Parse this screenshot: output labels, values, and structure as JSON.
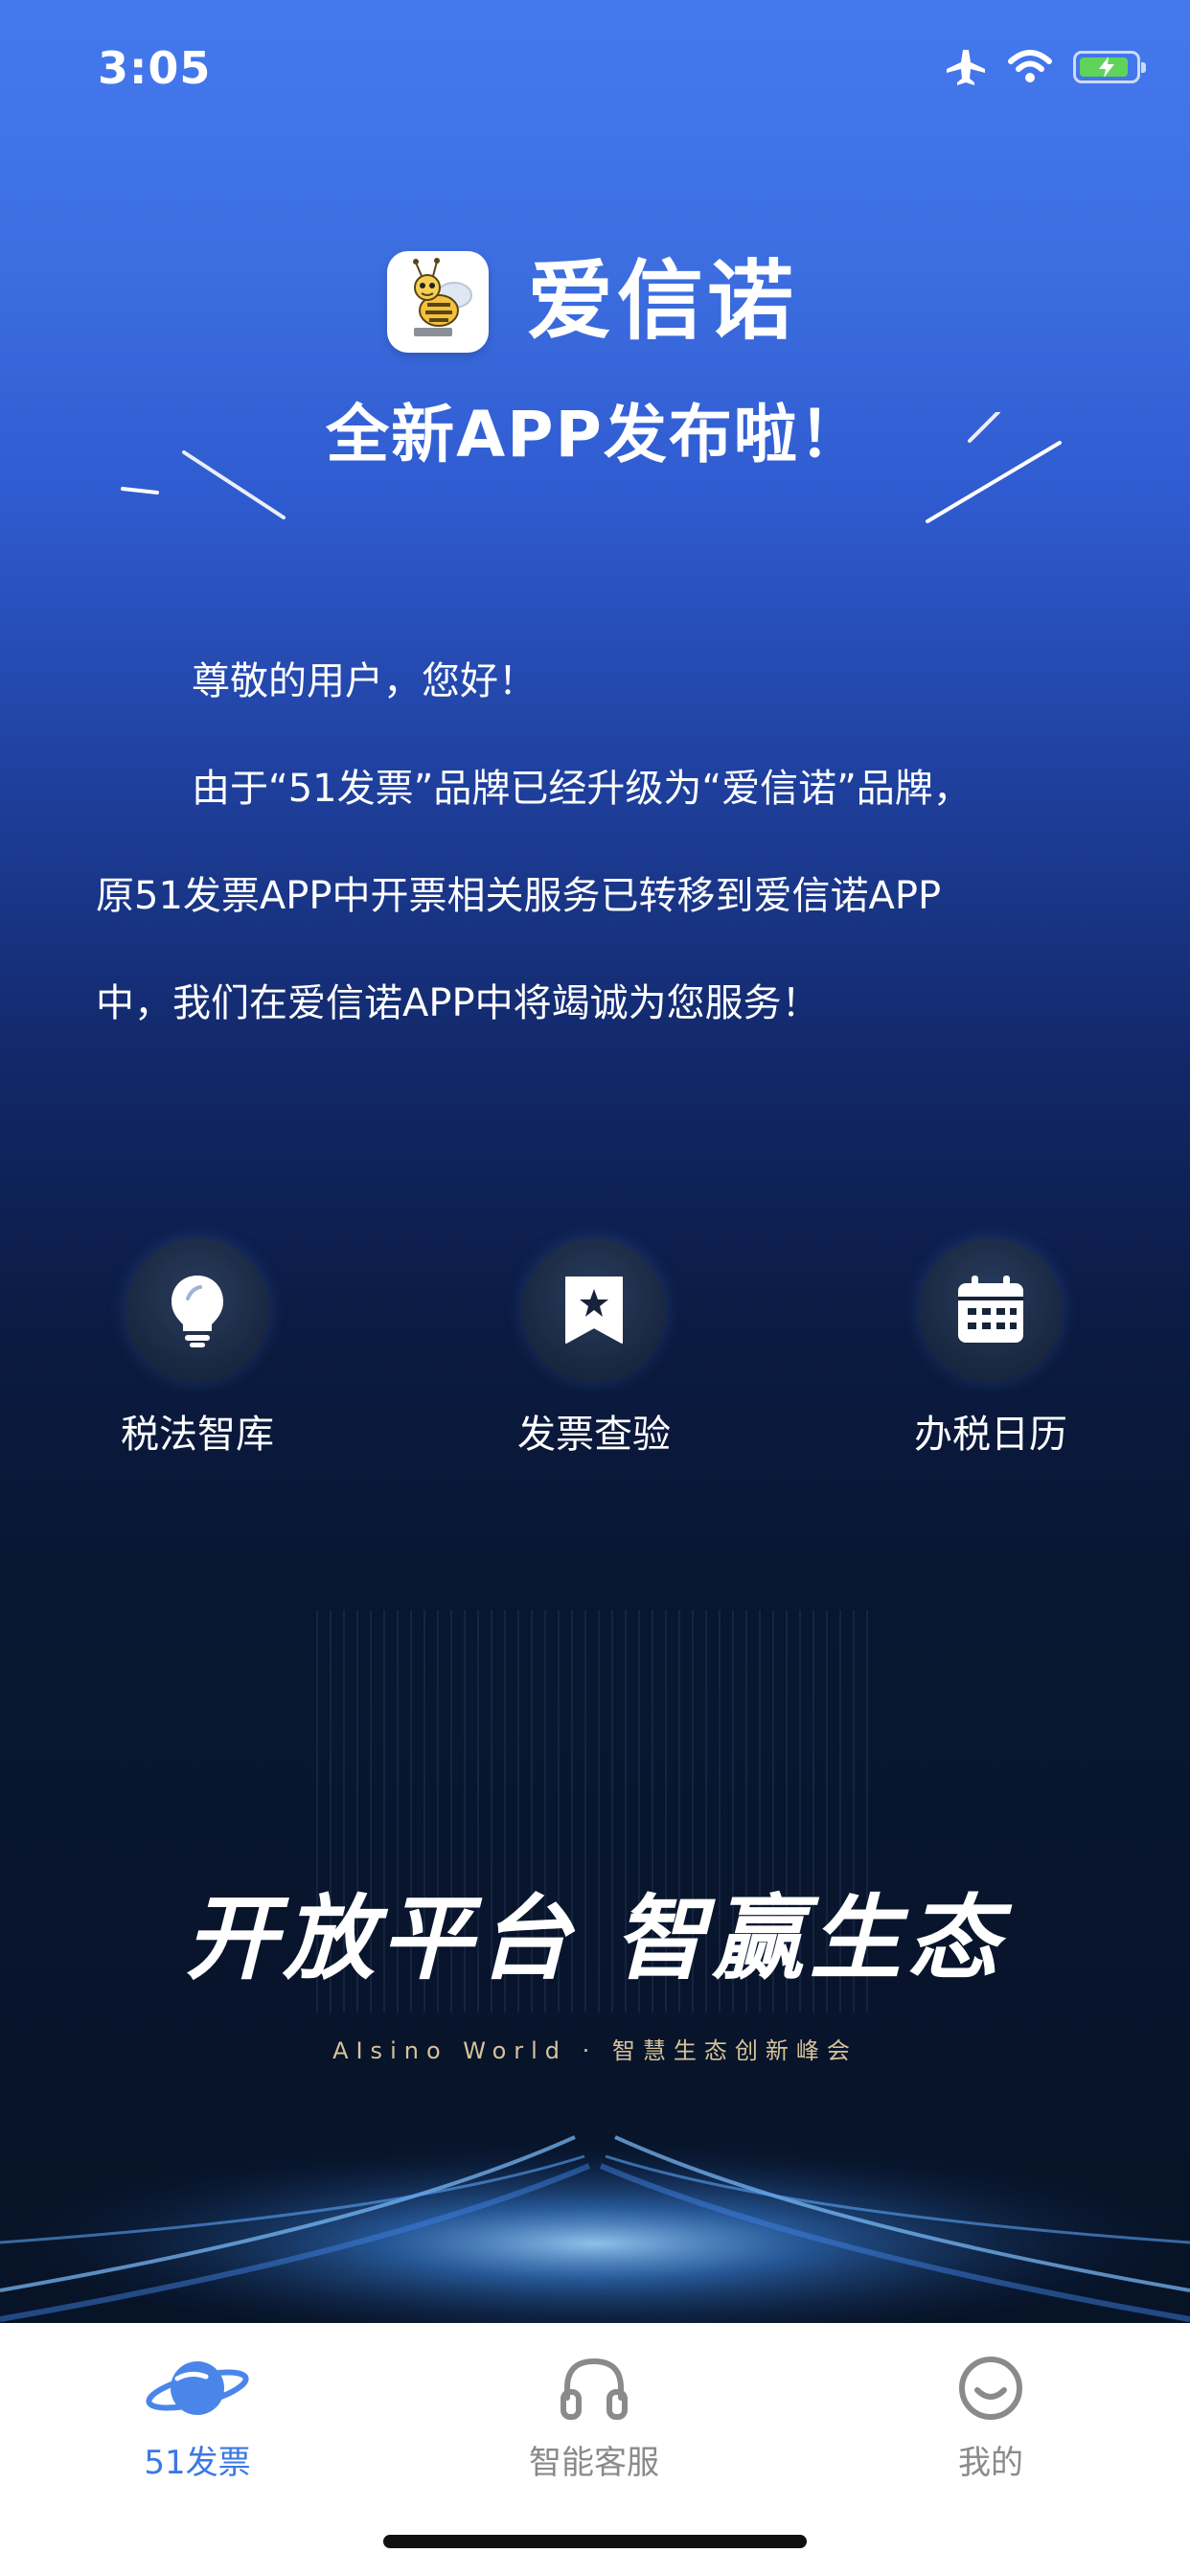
{
  "status_bar": {
    "time": "3:05"
  },
  "header": {
    "brand": "爱信诺",
    "subtitle": "全新APP发布啦！"
  },
  "letter": {
    "greeting": "尊敬的用户，您好！",
    "body_line1": "由于“51发票”品牌已经升级为“爱信诺”品牌，",
    "body_line2": "原51发票APP中开票相关服务已转移到爱信诺APP",
    "body_line3": "中，我们在爱信诺APP中将竭诚为您服务！"
  },
  "quick_actions": [
    {
      "label": "税法智库",
      "icon": "lightbulb-icon"
    },
    {
      "label": "发票查验",
      "icon": "bookmark-star-icon"
    },
    {
      "label": "办税日历",
      "icon": "calendar-icon"
    }
  ],
  "banner": {
    "slogan": "开放平台  智赢生态",
    "subline": "AIsino World · 智慧生态创新峰会"
  },
  "tab_bar": {
    "tabs": [
      {
        "label": "51发票",
        "icon": "planet-icon",
        "active": true
      },
      {
        "label": "智能客服",
        "icon": "headset-icon",
        "active": false
      },
      {
        "label": "我的",
        "icon": "smile-icon",
        "active": false
      }
    ]
  },
  "colors": {
    "accent": "#3a78e6",
    "inactive_tab": "#8a8a8a",
    "battery": "#5fd35a"
  }
}
